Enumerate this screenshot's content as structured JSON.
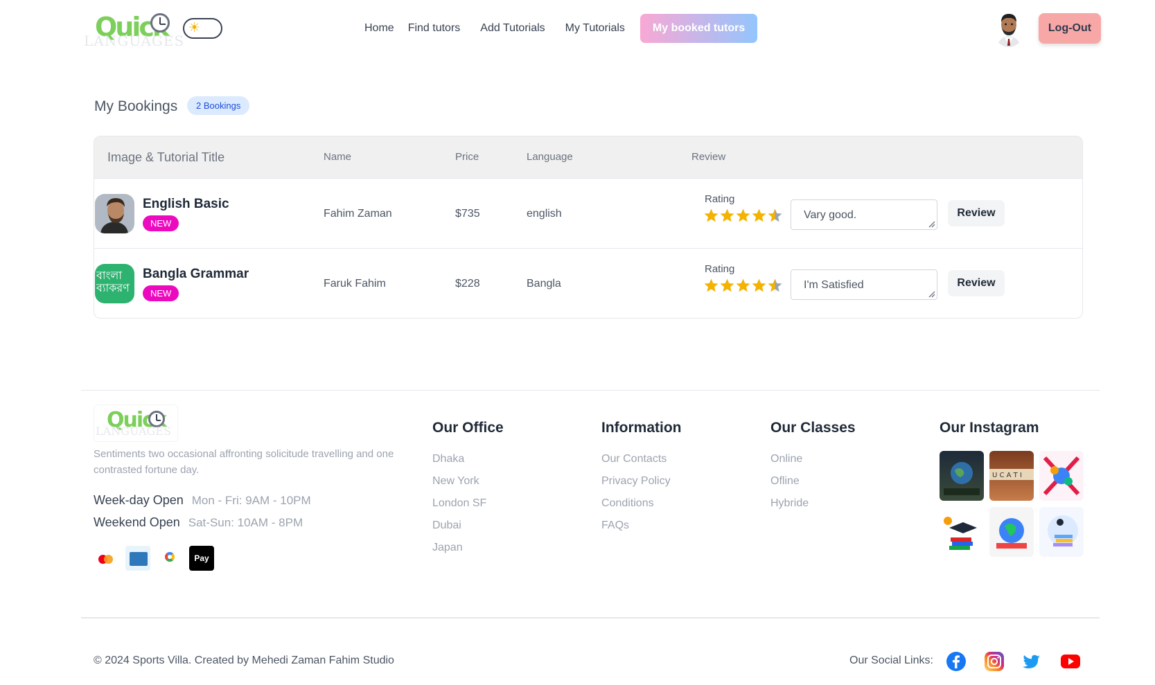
{
  "brand": {
    "logo_text": "Quick",
    "logo_subtext": "LANGUAGES"
  },
  "nav": {
    "links": [
      "Home",
      "Find tutors",
      "Add Tutorials",
      "My Tutorials"
    ],
    "active": "My booked tutors",
    "logout": "Log-Out",
    "active_gradient": [
      "#f9a8d4",
      "#93c5fd"
    ],
    "logout_color": "#f8a7a7"
  },
  "page": {
    "title": "My Bookings",
    "badge": "2 Bookings"
  },
  "table": {
    "headers": [
      "Image & Tutorial Title",
      "Name",
      "Price",
      "Language",
      "Review"
    ],
    "rows": [
      {
        "title": "English Basic",
        "badge": "NEW",
        "name": "Fahim Zaman",
        "price": "$735",
        "language": "english",
        "rating_label": "Rating",
        "rating": 4.5,
        "review_text": "Vary good.",
        "review_button": "Review",
        "thumb_icon": "man-portrait"
      },
      {
        "title": "Bangla Grammar",
        "badge": "NEW",
        "name": "Faruk Fahim",
        "price": "$228",
        "language": "Bangla",
        "rating_label": "Rating",
        "rating": 4.5,
        "review_text": "I'm Satisfied",
        "review_button": "Review",
        "thumb_line1": "বাংলা",
        "thumb_line2": "ব্যাকরণ"
      }
    ]
  },
  "footer": {
    "description": "Sentiments two occasional affronting solicitude travelling and one contrasted fortune day.",
    "hours": [
      {
        "label": "Week-day Open",
        "value": "Mon - Fri: 9AM - 10PM"
      },
      {
        "label": "Weekend Open",
        "value": "Sat-Sun: 10AM - 8PM"
      }
    ],
    "payments": [
      "mastercard-icon",
      "amex-icon",
      "google-pay-icon",
      "apple-pay-icon"
    ],
    "apple_pay_label": "Pay",
    "columns": [
      {
        "title": "Our Office",
        "links": [
          "Dhaka",
          "New York",
          "London SF",
          "Dubai",
          "Japan"
        ]
      },
      {
        "title": "Information",
        "links": [
          "Our Contacts",
          "Privacy Policy",
          "Conditions",
          "FAQs"
        ]
      },
      {
        "title": "Our Classes",
        "links": [
          "Online",
          "Ofline",
          "Hybride"
        ]
      },
      {
        "title": "Our Instagram",
        "links": []
      }
    ],
    "copyright": "© 2024 Sports Villa. Created by Mehedi Zaman Fahim Studio",
    "social_label": "Our Social Links:",
    "social_icons": [
      "facebook-icon",
      "instagram-icon",
      "twitter-icon",
      "youtube-icon"
    ]
  }
}
